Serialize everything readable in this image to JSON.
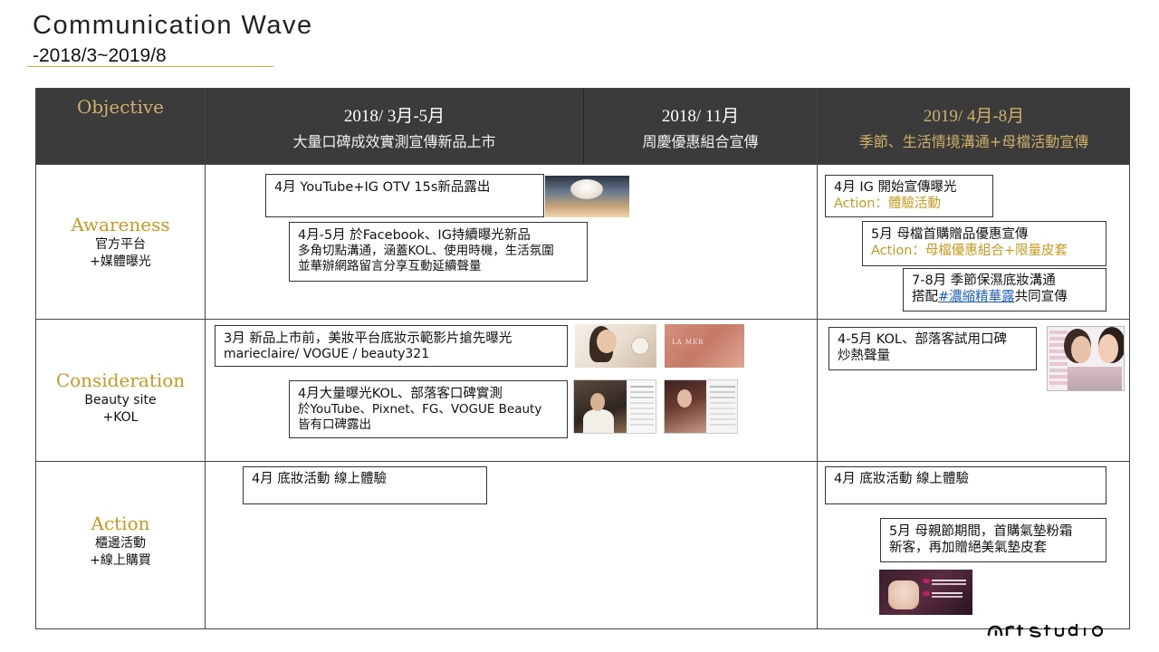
{
  "page": {
    "title": "Communication Wave",
    "subtitle": "-2018/3~2019/8"
  },
  "header": {
    "objective": "Objective",
    "columns": [
      {
        "period": "2018/ 3月-5月",
        "desc": "大量口碑成效實測宣傳新品上市"
      },
      {
        "period": "2018/ 11月",
        "desc": "周慶優惠組合宣傳"
      },
      {
        "period": "2019/ 4月-8月",
        "desc": "季節、生活情境溝通+母檔活動宣傳"
      }
    ]
  },
  "rows": [
    {
      "label": "Awareness",
      "sub1": "官方平台",
      "sub2": "+媒體曝光"
    },
    {
      "label": "Consideration",
      "sub1": "Beauty site",
      "sub2": "+KOL"
    },
    {
      "label": "Action",
      "sub1": "櫃邊活動",
      "sub2": "+線上購買"
    }
  ],
  "boxes": {
    "aw_yt": {
      "l1": "4月 YouTube+IG OTV 15s新品露出"
    },
    "aw_fb": {
      "l1": "4月-5月 於Facebook、IG持續曝光新品",
      "l2": "多角切點溝通，涵蓋KOL、使用時機，生活氛圍",
      "l3": "並華辦網路留言分享互動延續聲量"
    },
    "aw_ig19": {
      "l1": "4月 IG 開始宣傳曝光",
      "gold": "Action：體驗活動"
    },
    "aw_mom": {
      "l1": "5月 母檔首購贈品優惠宣傳",
      "gold": "Action：母檔優惠組合+限量皮套"
    },
    "aw_season": {
      "l1": "7-8月 季節保濕底妝溝通",
      "l2_pre": "搭配",
      "hashtag": "#濃縮精華露",
      "l2_post": "共同宣傳"
    },
    "co_launch": {
      "l1": "3月 新品上市前，美妝平台底妝示範影片搶先曝光",
      "l2": "marieclaire/ VOGUE / beauty321"
    },
    "co_kol": {
      "l1": "4月大量曝光KOL、部落客口碑實測",
      "l2": "於YouTube、Pixnet、FG、VOGUE Beauty",
      "l3": "皆有口碑露出"
    },
    "co_kol19": {
      "l1": "4-5月 KOL、部落客試用口碑",
      "l2": "炒熱聲量"
    },
    "ac_2018": {
      "l1": "4月 底妝活動  線上體驗"
    },
    "ac_2019": {
      "l1": "4月 底妝活動  線上體驗"
    },
    "ac_mom": {
      "l1": "5月 母親節期間，首購氣墊粉霜",
      "l2": "新客，再加贈絕美氣墊皮套"
    }
  },
  "images": {
    "pink_label": "LA MER"
  },
  "colors": {
    "header_bg": "#3b3b3b",
    "gold": "#c79a1e",
    "header_gold": "#cfb06a",
    "hashtag_blue": "#1f5fbf"
  }
}
